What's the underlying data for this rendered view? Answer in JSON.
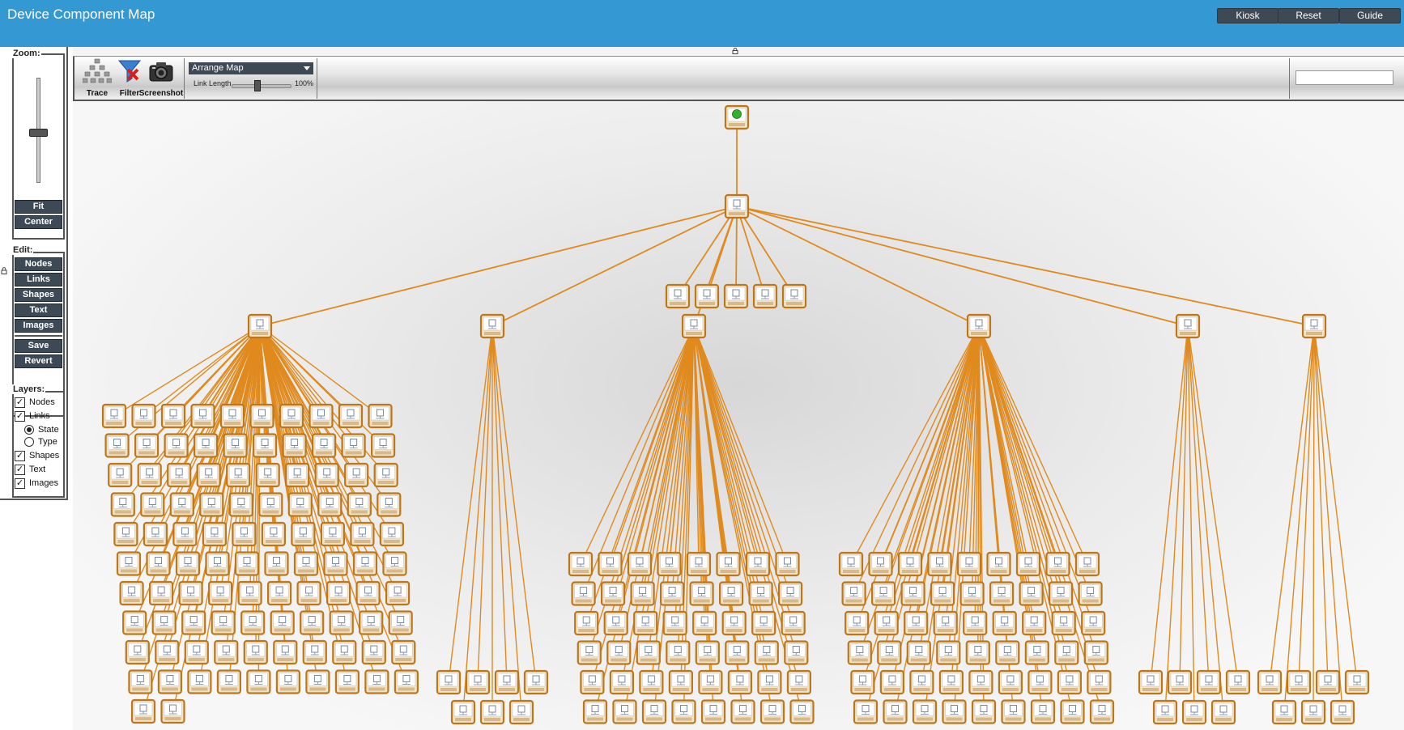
{
  "header": {
    "title": "Device Component Map",
    "buttons": [
      "Kiosk",
      "Reset",
      "Guide"
    ]
  },
  "zoom": {
    "legend": "Zoom:",
    "fit_label": "Fit",
    "center_label": "Center"
  },
  "edit": {
    "legend": "Edit:",
    "buttons": [
      "Nodes",
      "Links",
      "Shapes",
      "Text",
      "Images"
    ],
    "save_label": "Save",
    "revert_label": "Revert"
  },
  "layers": {
    "legend": "Layers:",
    "nodes": {
      "label": "Nodes",
      "checked": true
    },
    "links": {
      "label": "Links",
      "checked": true
    },
    "link_mode": {
      "state_label": "State",
      "type_label": "Type",
      "selected": "State"
    },
    "shapes": {
      "label": "Shapes",
      "checked": true
    },
    "text": {
      "label": "Text",
      "checked": true
    },
    "images": {
      "label": "Images",
      "checked": true
    }
  },
  "toolbar": {
    "trace_label": "Trace",
    "filter_label": "Filter",
    "screenshot_label": "Screenshot",
    "arrange_select": "Arrange Map",
    "link_length_label": "Link Length",
    "link_length_value": "100%",
    "search_value": ""
  },
  "colors": {
    "header": "#3498d3",
    "button": "#3d4a56",
    "link": "#e08a1e",
    "node_frame": "#b9771e",
    "root_status": "#35b030"
  },
  "map": {
    "root": {
      "icon": "green-globe-icon",
      "children": 1
    },
    "hub": {
      "icon": "device-icon",
      "children": 10
    },
    "branches": [
      {
        "id": "branch-a",
        "children": 102
      },
      {
        "id": "branch-b",
        "children": 7
      },
      {
        "id": "branch-c",
        "children": 67
      },
      {
        "id": "branch-d",
        "children": 65
      },
      {
        "id": "branch-e",
        "children": 7
      },
      {
        "id": "branch-f",
        "children": 7
      }
    ],
    "leaf_hub_children": 5
  }
}
